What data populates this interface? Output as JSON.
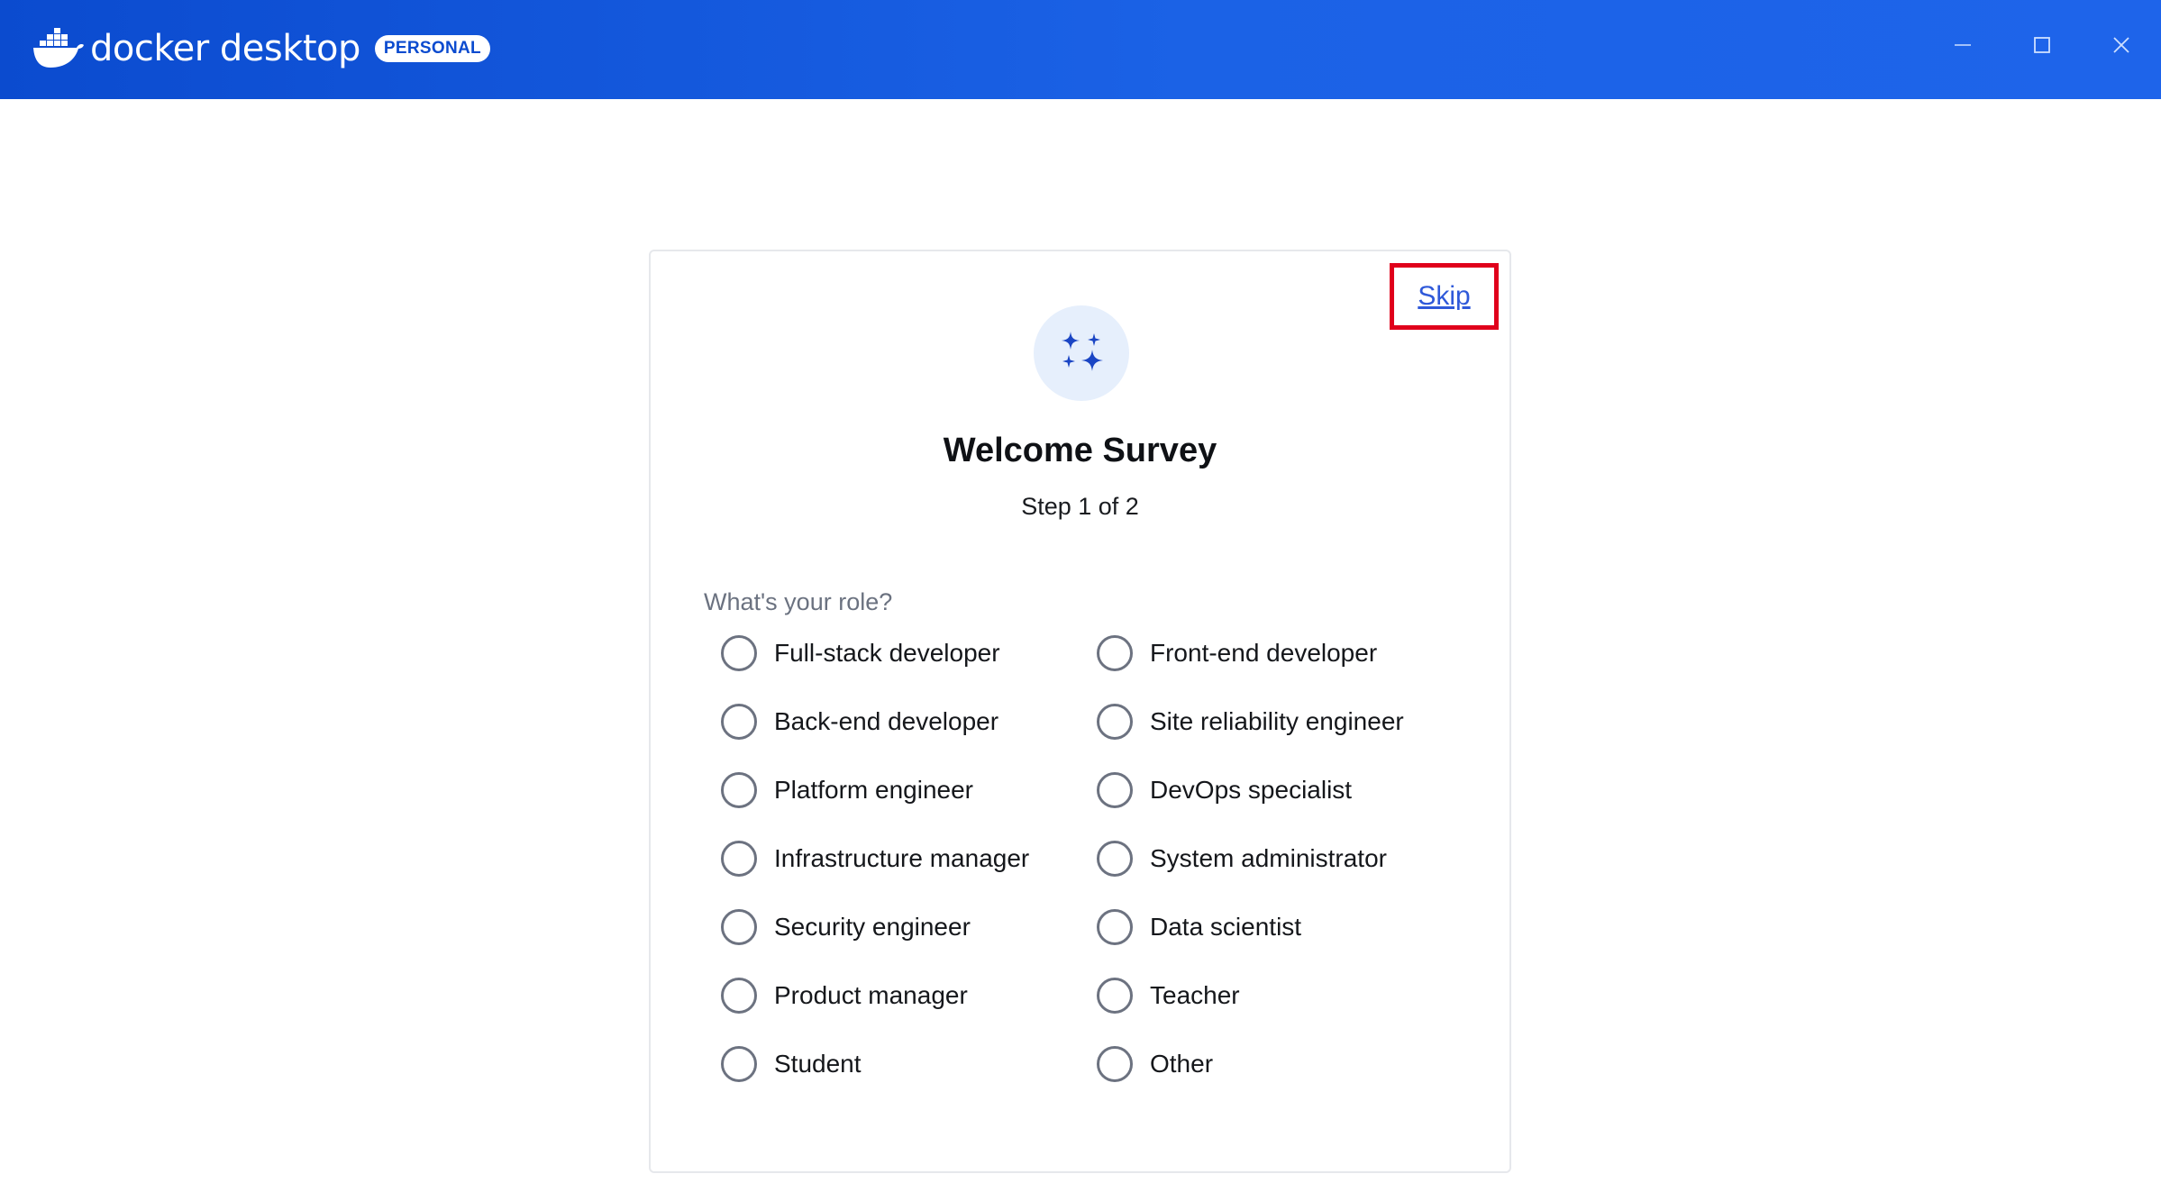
{
  "app": {
    "brand_text": "docker desktop",
    "badge": "PERSONAL",
    "colors": {
      "titlebar": "#1b62e6",
      "accent": "#2f59d9",
      "highlight_box": "#e0001b"
    }
  },
  "window_controls": {
    "minimize": "minimize-icon",
    "maximize": "maximize-icon",
    "close": "close-icon"
  },
  "survey": {
    "skip_label": "Skip",
    "icon": "sparkles-icon",
    "title": "Welcome Survey",
    "step": "Step 1 of 2",
    "question": "What's your role?",
    "left_options": [
      "Full-stack developer",
      "Back-end developer",
      "Platform engineer",
      "Infrastructure manager",
      "Security engineer",
      "Product manager",
      "Student"
    ],
    "right_options": [
      "Front-end developer",
      "Site reliability engineer",
      "DevOps specialist",
      "System administrator",
      "Data scientist",
      "Teacher",
      "Other"
    ],
    "selected": null
  }
}
